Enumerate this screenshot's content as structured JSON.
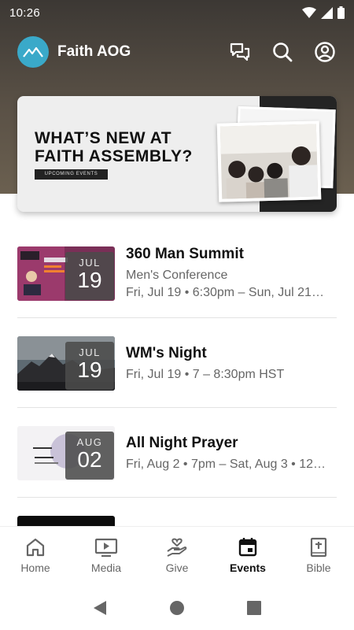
{
  "status_bar": {
    "time": "10:26"
  },
  "app_bar": {
    "title": "Faith AOG"
  },
  "banner": {
    "title_line1": "WHAT’S NEW AT",
    "title_line2": "FAITH ASSEMBLY?",
    "tag": "UPCOMING EVENTS"
  },
  "events": [
    {
      "month": "JUL",
      "day": "19",
      "title": "360 Man Summit",
      "subtitle": "Men's Conference",
      "time": "Fri, Jul 19 • 6:30pm – Sun, Jul 21…"
    },
    {
      "month": "JUL",
      "day": "19",
      "title": "WM's Night",
      "time": "Fri, Jul 19 • 7 – 8:30pm HST"
    },
    {
      "month": "AUG",
      "day": "02",
      "title": "All Night Prayer",
      "time": "Fri, Aug 2 • 7pm – Sat, Aug 3 • 12…"
    }
  ],
  "bottom_nav": [
    {
      "label": "Home",
      "icon": "home-icon"
    },
    {
      "label": "Media",
      "icon": "media-icon"
    },
    {
      "label": "Give",
      "icon": "give-icon"
    },
    {
      "label": "Events",
      "icon": "events-icon",
      "active": true
    },
    {
      "label": "Bible",
      "icon": "bible-icon"
    }
  ]
}
